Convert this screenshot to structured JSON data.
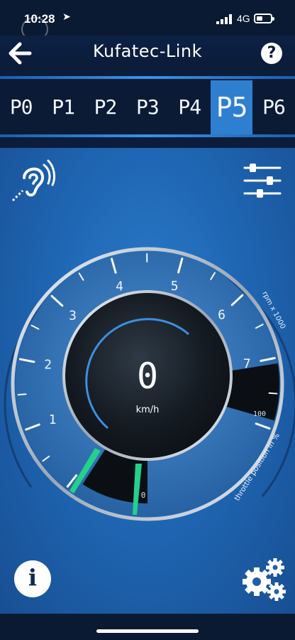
{
  "status": {
    "time": "10:28",
    "network": "4G"
  },
  "header": {
    "title": "Kufatec-Link"
  },
  "presets": {
    "items": [
      "P0",
      "P1",
      "P2",
      "P3",
      "P4",
      "P5",
      "P6"
    ],
    "active_index": 5
  },
  "gauge": {
    "speed_value": "0",
    "speed_unit": "km/h",
    "rpm_ticks": [
      "1",
      "2",
      "3",
      "4",
      "5",
      "6",
      "7"
    ],
    "rpm_scale_label": "rpm x 1000",
    "throttle_scale_label": "throttle position in %",
    "throttle_min_label": "0",
    "throttle_max_label": "100",
    "needle_color": "#23d08c",
    "accent_color": "#2f7fd0"
  }
}
